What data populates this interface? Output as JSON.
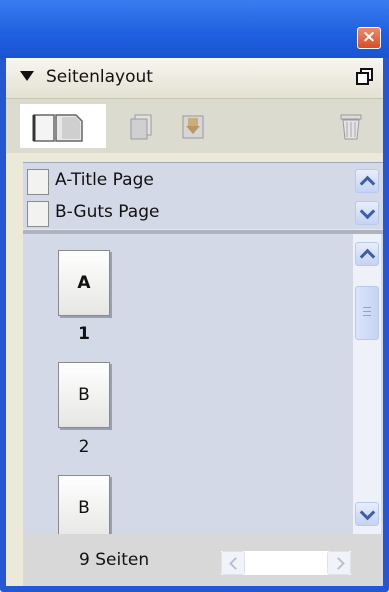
{
  "window": {
    "close_symbol": "×",
    "title_bar_color": "#2457d3"
  },
  "panel": {
    "title": "Seitenlayout",
    "collapse_icon": "triangle-down-icon",
    "menu_icon": "panel-options-icon"
  },
  "toolbar": {
    "items": [
      "spread-view-icon",
      "new-page-icon",
      "insert-page-icon",
      "trash-icon"
    ]
  },
  "masters": [
    {
      "label": "A-Title Page"
    },
    {
      "label": "B-Guts Page"
    }
  ],
  "pages": [
    {
      "letter": "A",
      "number": "1",
      "bold": true
    },
    {
      "letter": "B",
      "number": "2",
      "bold": false
    },
    {
      "letter": "B",
      "number": "",
      "bold": false
    }
  ],
  "footer": {
    "page_count": "9 Seiten"
  }
}
